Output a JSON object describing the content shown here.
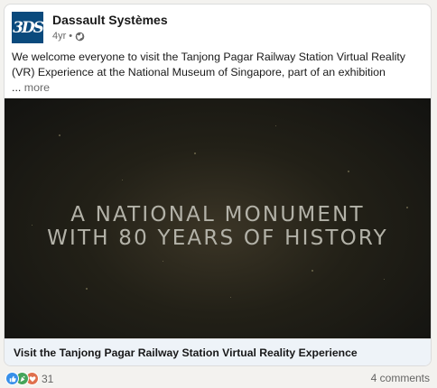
{
  "post": {
    "author": "Dassault Systèmes",
    "logo_text": "3DS",
    "age": "4yr",
    "separator": "•",
    "visibility_icon": "globe-icon",
    "text_lines": [
      "We welcome everyone to visit the Tanjong Pagar Railway Station Virtual Reality",
      "(VR) Experience at the National Museum of Singapore, part of an exhibition"
    ],
    "ellipsis": "...",
    "more_label": "more"
  },
  "video": {
    "line1": "A NATIONAL MONUMENT",
    "line2": "WITH 80 YEARS OF HISTORY"
  },
  "link_caption": "Visit the Tanjong Pagar Railway Station Virtual Reality Experience",
  "social": {
    "reaction_icons": [
      "like-icon",
      "celebrate-icon",
      "love-icon"
    ],
    "reaction_count": "31",
    "comments": "4 comments"
  },
  "colors": {
    "brand": "#0a4a7d",
    "caption_bg": "#eef3f8",
    "like": "#378fe9",
    "celebrate": "#44a45a",
    "love": "#df704d"
  }
}
